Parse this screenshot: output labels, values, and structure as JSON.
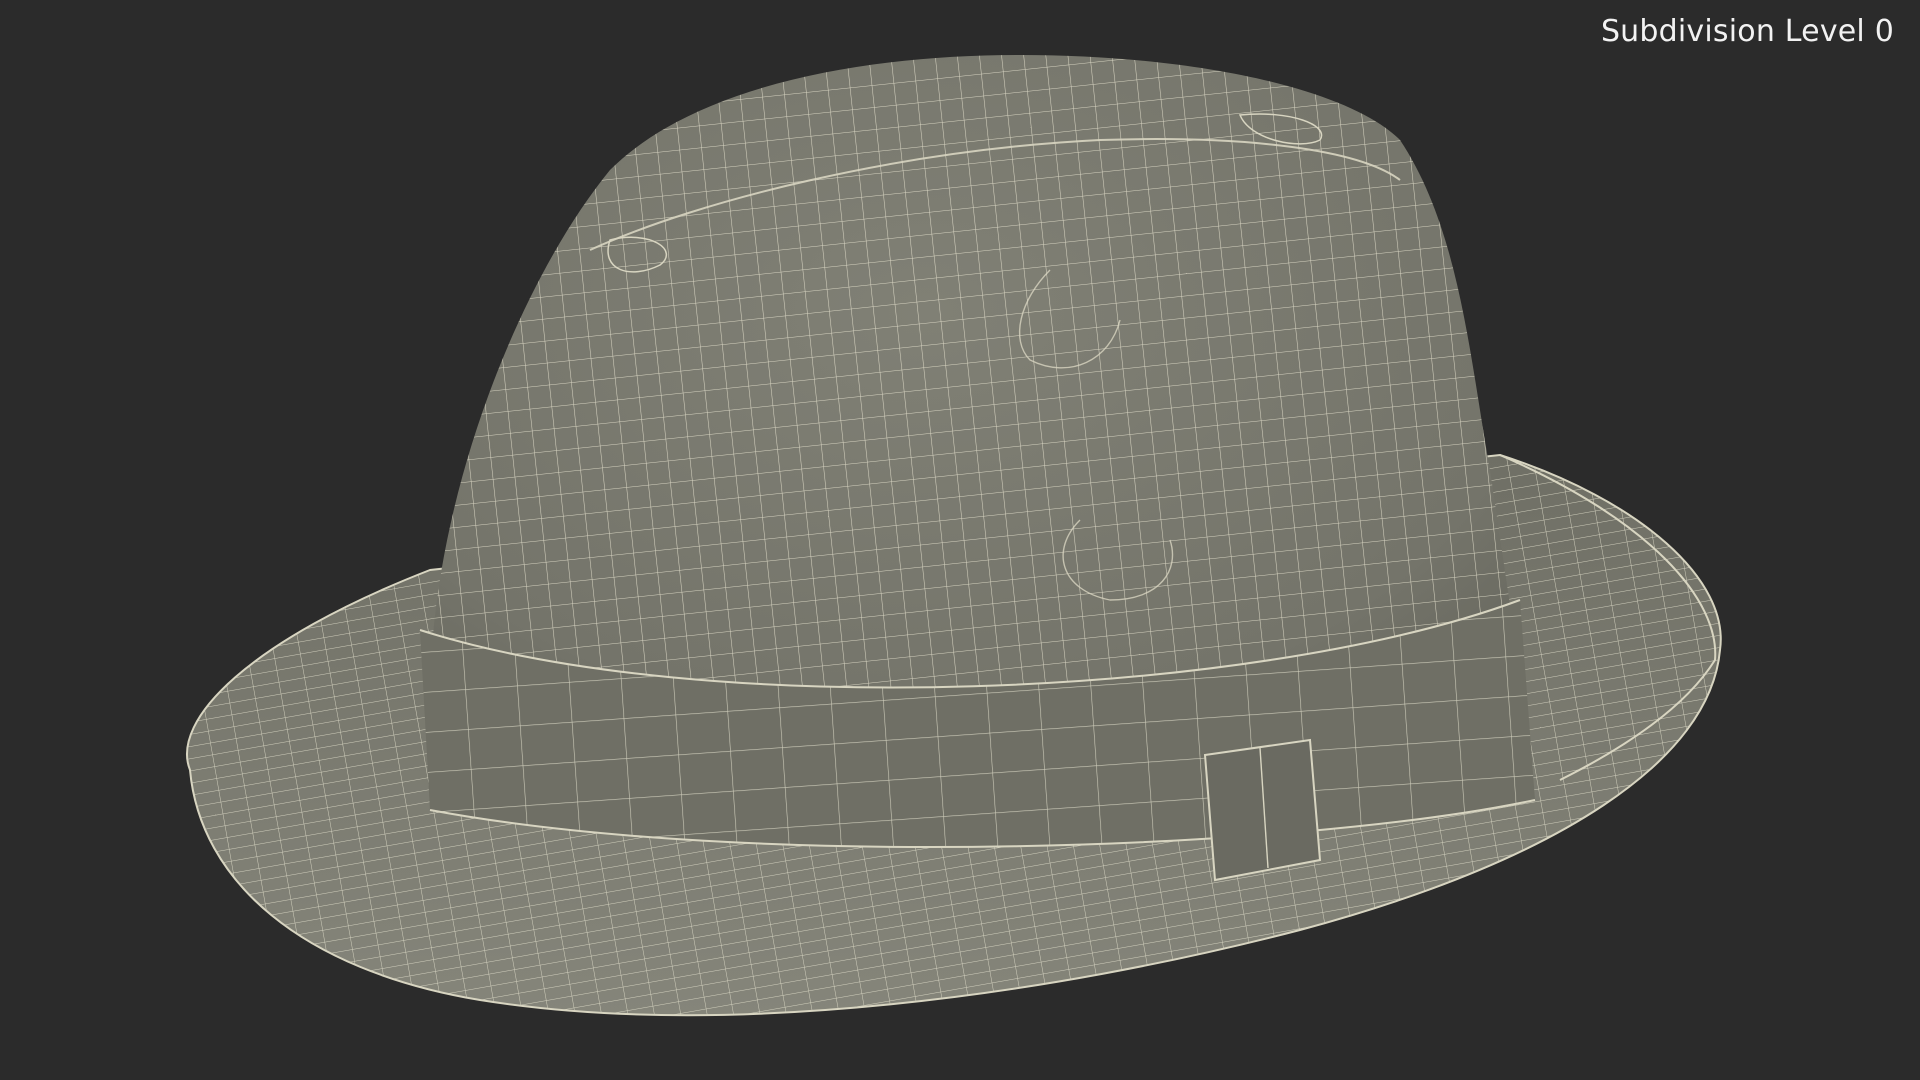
{
  "viewport": {
    "overlay_label": "Subdivision Level 0"
  },
  "colors": {
    "background": "#2b2b2b",
    "surface": "#77776c",
    "surface_dark": "#5e5e55",
    "wire": "#e6e3cf"
  },
  "subject": {
    "object_icon": "fedora-hat-wireframe-icon"
  }
}
